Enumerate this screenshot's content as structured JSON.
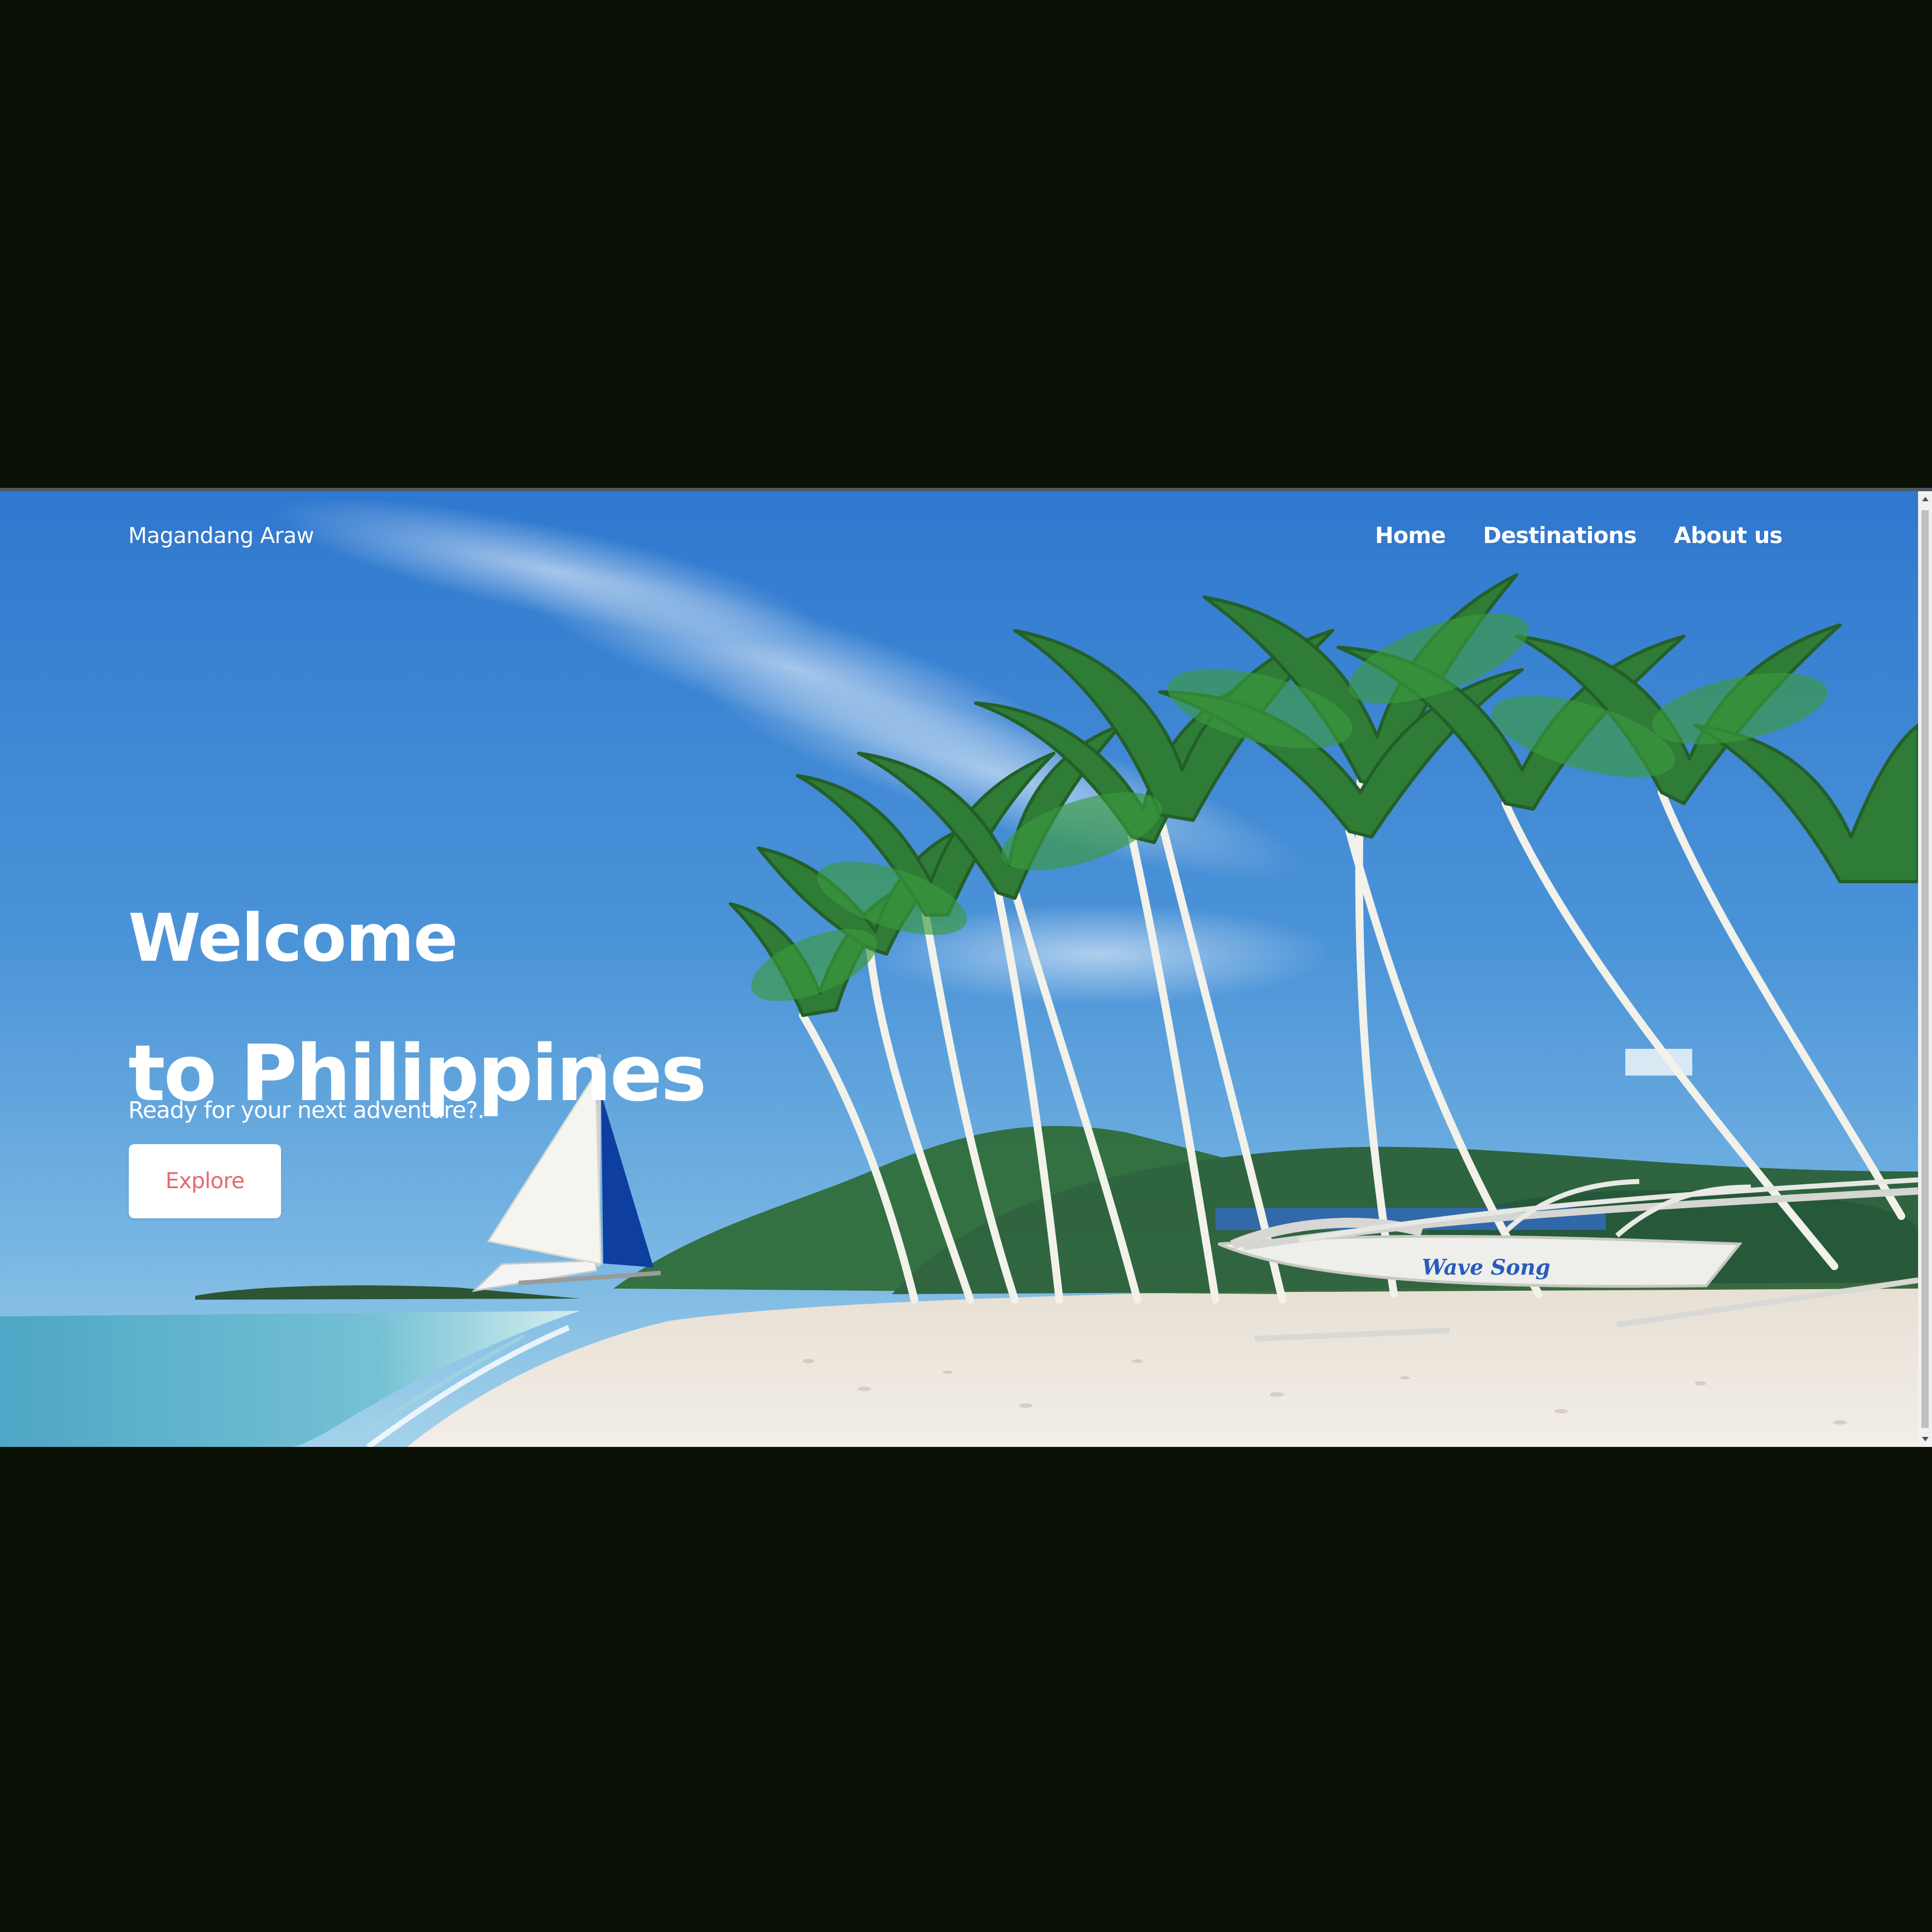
{
  "brand": {
    "name": "Magandang Araw"
  },
  "navigation": {
    "links": [
      {
        "label": "Home"
      },
      {
        "label": "Destinations"
      },
      {
        "label": "About us"
      }
    ]
  },
  "hero": {
    "title_line_1": "Welcome",
    "title_line_2": "to Philippines",
    "subtitle": "Ready for your next adventure?.",
    "button_label": "Explore",
    "boat_name": "Wave Song"
  },
  "colors": {
    "page_background": "#0b1205",
    "sky": "#2f7ad0",
    "button_text": "#e46a6e",
    "button_background": "#ffffff",
    "sand": "#eae3d8",
    "sea": "#6ab8d0"
  },
  "icons": {
    "scroll_up": "scroll-up-arrow-icon",
    "scroll_down": "scroll-down-arrow-icon"
  }
}
